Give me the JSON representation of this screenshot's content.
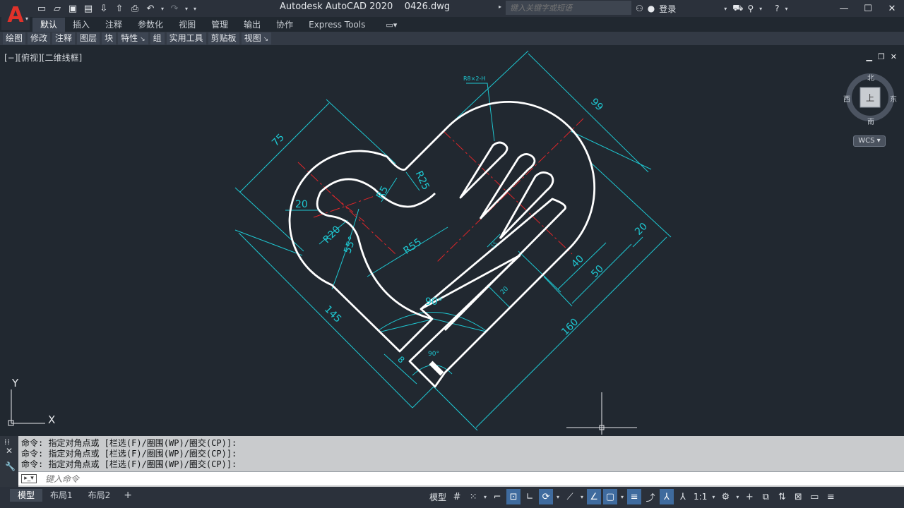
{
  "titlebar": {
    "app_name": "Autodesk AutoCAD 2020",
    "file_name": "0426.dwg",
    "search_placeholder": "键入关键字或短语",
    "login_label": "登录",
    "qat_icons": [
      "new-icon",
      "open-icon",
      "save-icon",
      "save-as-icon",
      "web-open-icon",
      "web-save-icon",
      "print-icon",
      "undo-icon",
      "redo-icon",
      "customize-icon"
    ],
    "window_controls": [
      "minimize-icon",
      "restore-icon",
      "close-icon"
    ]
  },
  "ribbon": {
    "tabs": [
      "默认",
      "插入",
      "注释",
      "参数化",
      "视图",
      "管理",
      "输出",
      "协作",
      "Express Tools"
    ],
    "active_tab": "默认",
    "panels": [
      {
        "label": "绘图",
        "overflow": false
      },
      {
        "label": "修改",
        "overflow": false
      },
      {
        "label": "注释",
        "overflow": false
      },
      {
        "label": "图层",
        "overflow": false
      },
      {
        "label": "块",
        "overflow": false
      },
      {
        "label": "特性",
        "overflow": true
      },
      {
        "label": "组",
        "overflow": false
      },
      {
        "label": "实用工具",
        "overflow": false
      },
      {
        "label": "剪贴板",
        "overflow": false
      },
      {
        "label": "视图",
        "overflow": true
      }
    ]
  },
  "canvas": {
    "viewport_label": "[−][俯视][二维线框]",
    "viewcube": {
      "north": "北",
      "south": "南",
      "east": "东",
      "west": "西",
      "face": "上",
      "wcs": "WCS"
    },
    "ucs": {
      "x_label": "X",
      "y_label": "Y"
    },
    "dimensions": {
      "d75": "75",
      "d99": "99",
      "d20_left": "20",
      "r5": "R5",
      "r25": "R25",
      "r20": "R20",
      "a55": "55°",
      "r55": "R55",
      "d145": "145",
      "a90": "90°",
      "a90_small": "90°",
      "d8": "8",
      "d20_inner": "20",
      "d40": "40",
      "d50": "50",
      "d20_right": "20",
      "d160": "160",
      "leader_note": "R8×2-H",
      "d15": "15"
    },
    "colors": {
      "background": "#212830",
      "geometry": "#ffffff",
      "dimension": "#1ec8d2",
      "centerline": "#e0262a"
    }
  },
  "command": {
    "history": [
      "命令: 指定对角点或 [栏选(F)/圈围(WP)/圈交(CP)]:",
      "命令: 指定对角点或 [栏选(F)/圈围(WP)/圈交(CP)]:",
      "命令: 指定对角点或 [栏选(F)/圈围(WP)/圈交(CP)]:"
    ],
    "input_placeholder": "键入命令"
  },
  "status": {
    "layout_tabs": [
      "模型",
      "布局1",
      "布局2"
    ],
    "active_layout": "模型",
    "model_label": "模型",
    "scale_label": "1:1"
  }
}
